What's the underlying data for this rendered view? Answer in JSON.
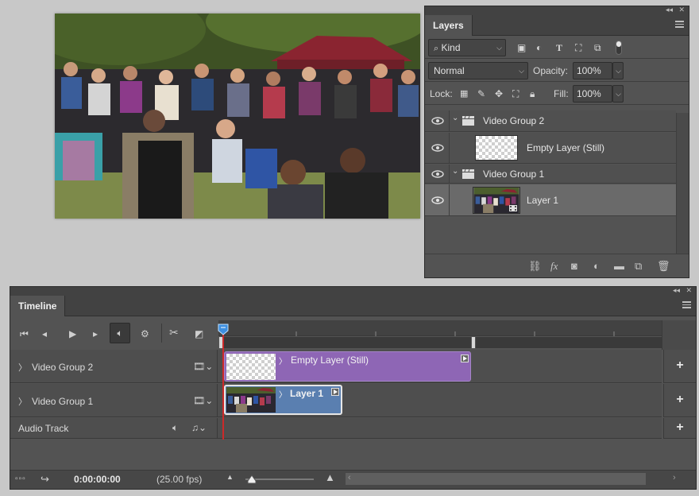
{
  "canvas": {
    "image_description_icon": "photo-icon"
  },
  "layers_panel": {
    "tab_label": "Layers",
    "filter": {
      "icon": "search-icon",
      "value": "Kind"
    },
    "blend_mode": "Normal",
    "opacity_label": "Opacity:",
    "opacity_value": "100%",
    "lock_label": "Lock:",
    "fill_label": "Fill:",
    "fill_value": "100%",
    "layers": [
      {
        "name": "Video Group 2",
        "type": "video-group"
      },
      {
        "name": "Empty Layer (Still)",
        "type": "layer"
      },
      {
        "name": "Video Group 1",
        "type": "video-group"
      },
      {
        "name": "Layer 1",
        "type": "layer",
        "selected": true
      }
    ],
    "bottom_icons": [
      "link-icon",
      "fx-icon",
      "mask-icon",
      "adjustment-icon",
      "folder-icon",
      "new-layer-icon",
      "trash-icon"
    ]
  },
  "timeline_panel": {
    "tab_label": "Timeline",
    "tracks": [
      {
        "name": "Video Group 2",
        "clip_label": "Empty Layer (Still)"
      },
      {
        "name": "Video Group 1",
        "clip_label": "Layer 1"
      },
      {
        "name": "Audio Track"
      }
    ],
    "timecode": "0:00:00:00",
    "fps": "(25.00 fps)",
    "add_track_symbol": "+",
    "colors": {
      "video_group_2_clip": "#8e66b5",
      "video_group_1_clip": "#5a7fb0",
      "playhead": "#cc2a2a",
      "playhead_handle": "#3d8fe0"
    }
  }
}
